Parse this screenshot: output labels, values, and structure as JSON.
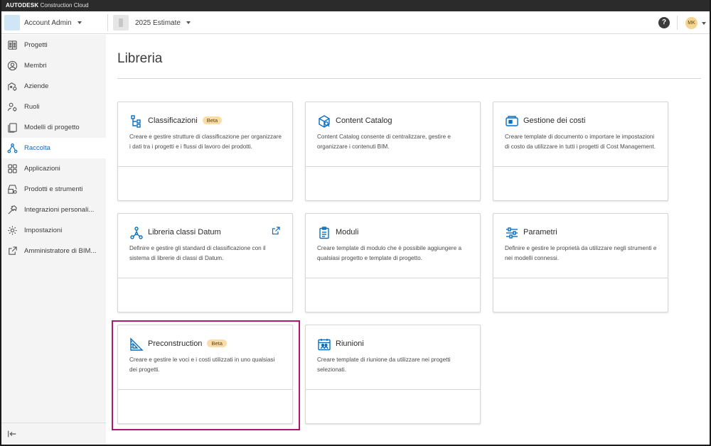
{
  "brand": {
    "bold": "AUTODESK",
    "light": "Construction Cloud"
  },
  "header": {
    "account_name": "Account Admin",
    "project_name": "2025 Estimate",
    "help_label": "?",
    "user_initials": "MK"
  },
  "sidebar": {
    "items": [
      {
        "label": "Progetti",
        "icon": "building-icon",
        "active": false
      },
      {
        "label": "Membri",
        "icon": "user-circle-icon",
        "active": false
      },
      {
        "label": "Aziende",
        "icon": "company-gear-icon",
        "active": false
      },
      {
        "label": "Ruoli",
        "icon": "role-gear-icon",
        "active": false
      },
      {
        "label": "Modelli di progetto",
        "icon": "template-icon",
        "active": false
      },
      {
        "label": "Raccolta",
        "icon": "network-icon",
        "active": true
      },
      {
        "label": "Applicazioni",
        "icon": "apps-grid-icon",
        "active": false
      },
      {
        "label": "Prodotti e strumenti",
        "icon": "products-gear-icon",
        "active": false
      },
      {
        "label": "Integrazioni personali...",
        "icon": "hammer-icon",
        "active": false
      },
      {
        "label": "Impostazioni",
        "icon": "settings-gear-icon",
        "active": false
      },
      {
        "label": "Amministratore di BIM...",
        "icon": "external-link-icon",
        "active": false
      }
    ]
  },
  "main": {
    "title": "Libreria",
    "cards": [
      {
        "title": "Classificazioni",
        "badge": "Beta",
        "desc": "Creare e gestire strutture di classificazione per organizzare i dati tra i progetti e i flussi di lavoro dei prodotti."
      },
      {
        "title": "Content Catalog",
        "badge": "",
        "desc": "Content Catalog consente di centralizzare, gestire e organizzare i contenuti BIM."
      },
      {
        "title": "Gestione dei costi",
        "badge": "",
        "desc": "Creare template di documento o importare le impostazioni di costo da utilizzare in tutti i progetti di Cost Management."
      },
      {
        "title": "Libreria classi Datum",
        "badge": "",
        "desc": "Definire e gestire gli standard di classificazione con il sistema di librerie di classi di Datum."
      },
      {
        "title": "Moduli",
        "badge": "",
        "desc": "Creare template di modulo che è possibile aggiungere a qualsiasi progetto e template di progetto."
      },
      {
        "title": "Parametri",
        "badge": "",
        "desc": "Definire e gestire le proprietà da utilizzare negli strumenti e nei modelli connessi."
      },
      {
        "title": "Preconstruction",
        "badge": "Beta",
        "desc": "Creare e gestire le voci e i costi utilizzati in uno qualsiasi dei progetti."
      },
      {
        "title": "Riunioni",
        "badge": "",
        "desc": "Creare template di riunione da utilizzare nei progetti selezionati."
      }
    ]
  },
  "colors": {
    "accent": "#0a6ec2",
    "badge_bg": "#f9dca7",
    "highlight": "#b0176b"
  }
}
